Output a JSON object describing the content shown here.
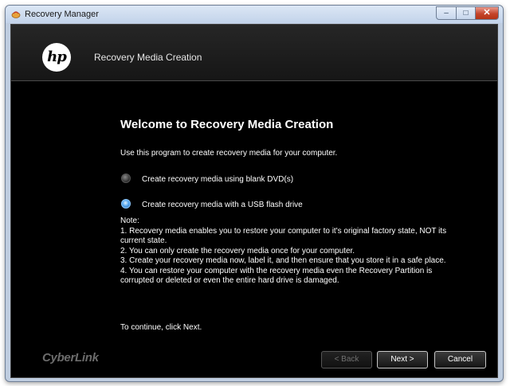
{
  "window": {
    "title": "Recovery Manager",
    "controls": {
      "minimize": "–",
      "maximize": "□",
      "close": "✕"
    }
  },
  "header": {
    "logo_text": "hp",
    "title": "Recovery Media Creation"
  },
  "main": {
    "heading": "Welcome to Recovery Media Creation",
    "intro": "Use this program to create recovery media for your computer.",
    "options": [
      {
        "label": "Create recovery media using blank DVD(s)",
        "selected": false
      },
      {
        "label": "Create recovery media with a USB flash drive",
        "selected": true
      }
    ],
    "notes": {
      "heading": "Note:",
      "lines": [
        "1. Recovery media enables you to restore your computer to it's original factory state, NOT its current state.",
        "2. You can only create the recovery media once for your computer.",
        "3. Create your recovery media now, label it, and then ensure that you store it in a safe place.",
        "4. You can restore your computer with the recovery media even the Recovery Partition is corrupted or deleted or even the entire hard drive is damaged."
      ]
    },
    "continue_text": "To continue, click Next."
  },
  "footer": {
    "brand": "CyberLink",
    "back_label": "< Back",
    "next_label": "Next >",
    "cancel_label": "Cancel"
  },
  "colors": {
    "background": "#000000",
    "text": "#ffffff",
    "radio_selected": "#5aaaf0"
  }
}
